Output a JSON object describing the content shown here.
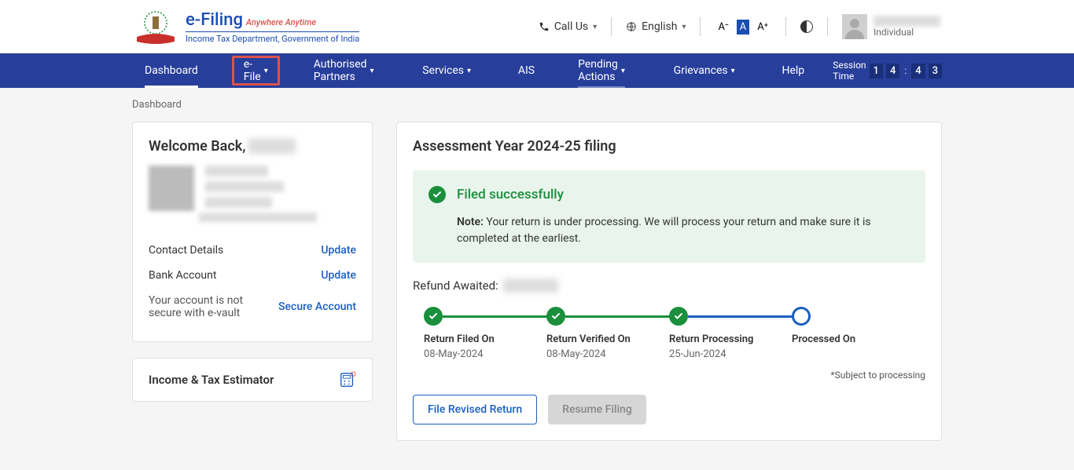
{
  "header": {
    "logo_title": "e-Filing",
    "logo_tagline": "Anywhere Anytime",
    "logo_sub": "Income Tax Department, Government of India",
    "call_us": "Call Us",
    "language": "English",
    "font_small": "A⁻",
    "font_normal": "A",
    "font_large": "A⁺",
    "user_type": "Individual"
  },
  "nav": {
    "dashboard": "Dashboard",
    "efile": "e-File",
    "partners": "Authorised Partners",
    "services": "Services",
    "ais": "AIS",
    "pending": "Pending Actions",
    "grievances": "Grievances",
    "help": "Help",
    "session_label": "Session Time",
    "session_m1": "1",
    "session_m2": "4",
    "session_s1": "4",
    "session_s2": "3"
  },
  "breadcrumb": "Dashboard",
  "welcome": {
    "title": "Welcome Back, ",
    "contact_label": "Contact Details",
    "contact_link": "Update",
    "bank_label": "Bank Account",
    "bank_link": "Update",
    "secure_desc": "Your account is not secure with e-vault",
    "secure_link": "Secure Account"
  },
  "estimator": {
    "title": "Income & Tax Estimator"
  },
  "filing": {
    "title": "Assessment Year 2024-25 filing",
    "status_title": "Filed successfully",
    "note_label": "Note:",
    "note_text": " Your return is under processing. We will process your return and make sure it is completed at the earliest.",
    "refund_label": "Refund Awaited:",
    "steps": [
      {
        "label": "Return Filed On",
        "date": "08-May-2024"
      },
      {
        "label": "Return Verified On",
        "date": "08-May-2024"
      },
      {
        "label": "Return Processing",
        "date": "25-Jun-2024"
      },
      {
        "label": "Processed On",
        "date": ""
      }
    ],
    "disclaimer": "*Subject to processing",
    "btn_revised": "File Revised Return",
    "btn_resume": "Resume Filing"
  }
}
